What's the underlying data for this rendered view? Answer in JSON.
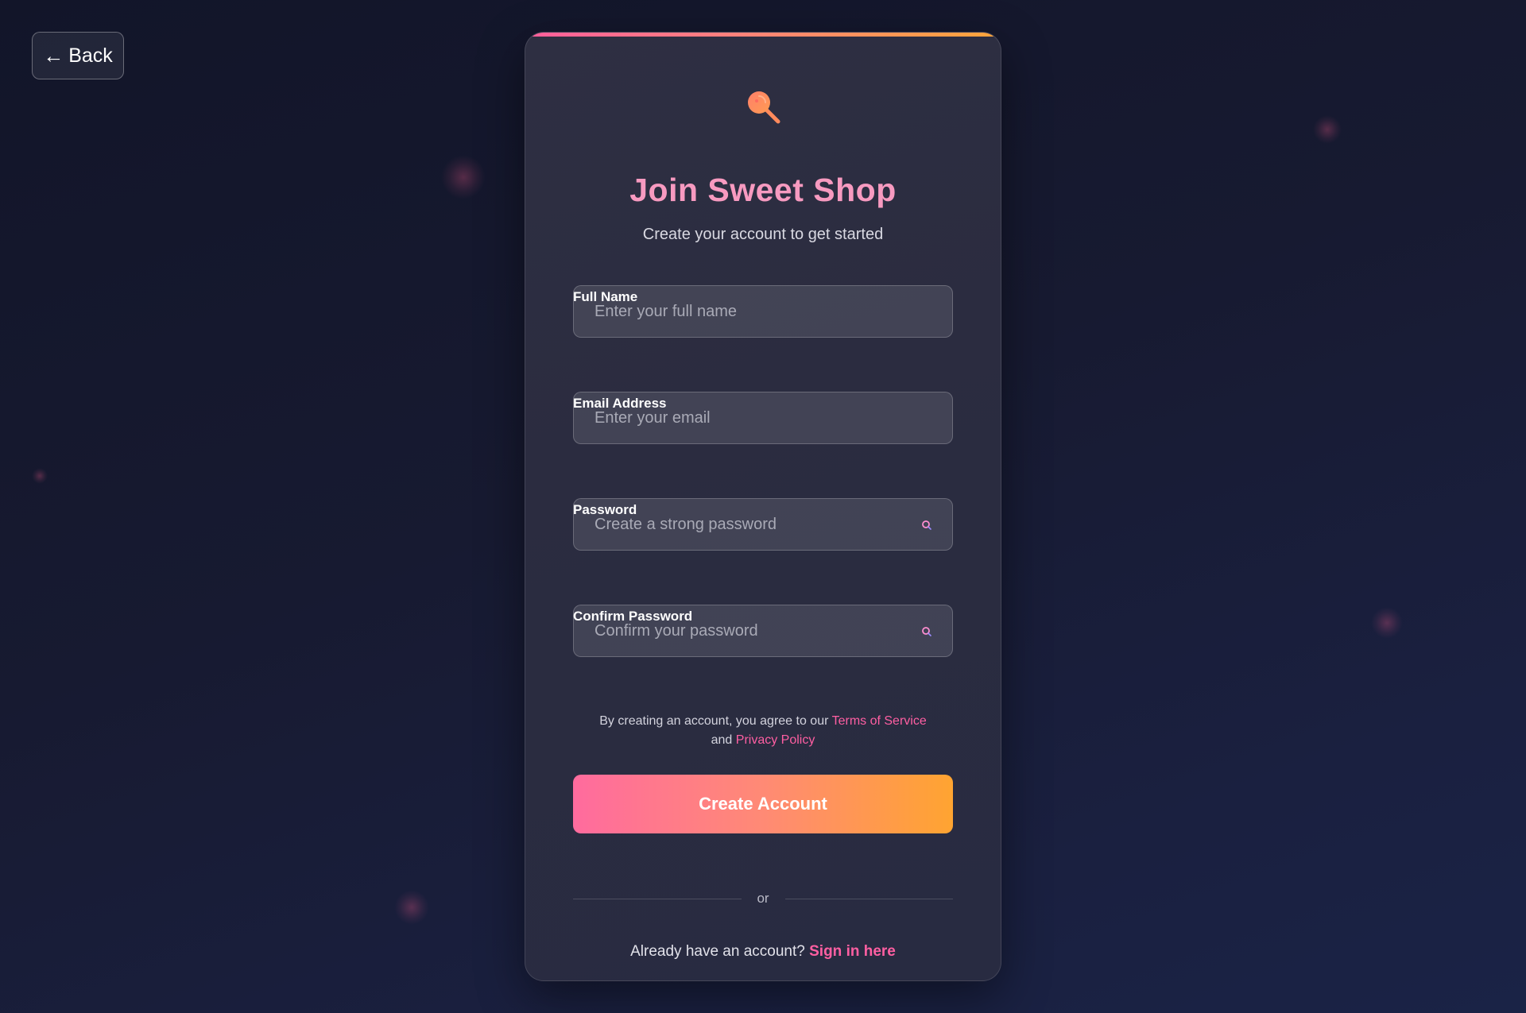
{
  "nav": {
    "back_arrow": "←",
    "back_label": "Back"
  },
  "card": {
    "logo_icon": "lollipop-icon",
    "title": "Join Sweet Shop",
    "subtitle": "Create your account to get started"
  },
  "form": {
    "full_name": {
      "label": "Full Name",
      "placeholder": "Enter your full name",
      "value": ""
    },
    "email": {
      "label": "Email Address",
      "placeholder": "Enter your email",
      "value": ""
    },
    "password": {
      "label": "Password",
      "placeholder": "Create a strong password",
      "value": "",
      "toggle_icon": "eye-icon"
    },
    "confirm_password": {
      "label": "Confirm Password",
      "placeholder": "Confirm your password",
      "value": "",
      "toggle_icon": "eye-icon"
    },
    "terms": {
      "prefix": "By creating an account, you agree to our",
      "terms_link": "Terms of Service",
      "connector": "and",
      "privacy_link": "Privacy Policy"
    },
    "submit_label": "Create Account"
  },
  "divider": {
    "text": "or"
  },
  "signin": {
    "prompt": "Already have an account?",
    "link": "Sign in here"
  },
  "colors": {
    "accent_pink": "#ff5fa2",
    "accent_orange": "#ffa431",
    "title_pink": "#f79ac0",
    "background": "#141730",
    "card_background": "#2d2e42"
  }
}
